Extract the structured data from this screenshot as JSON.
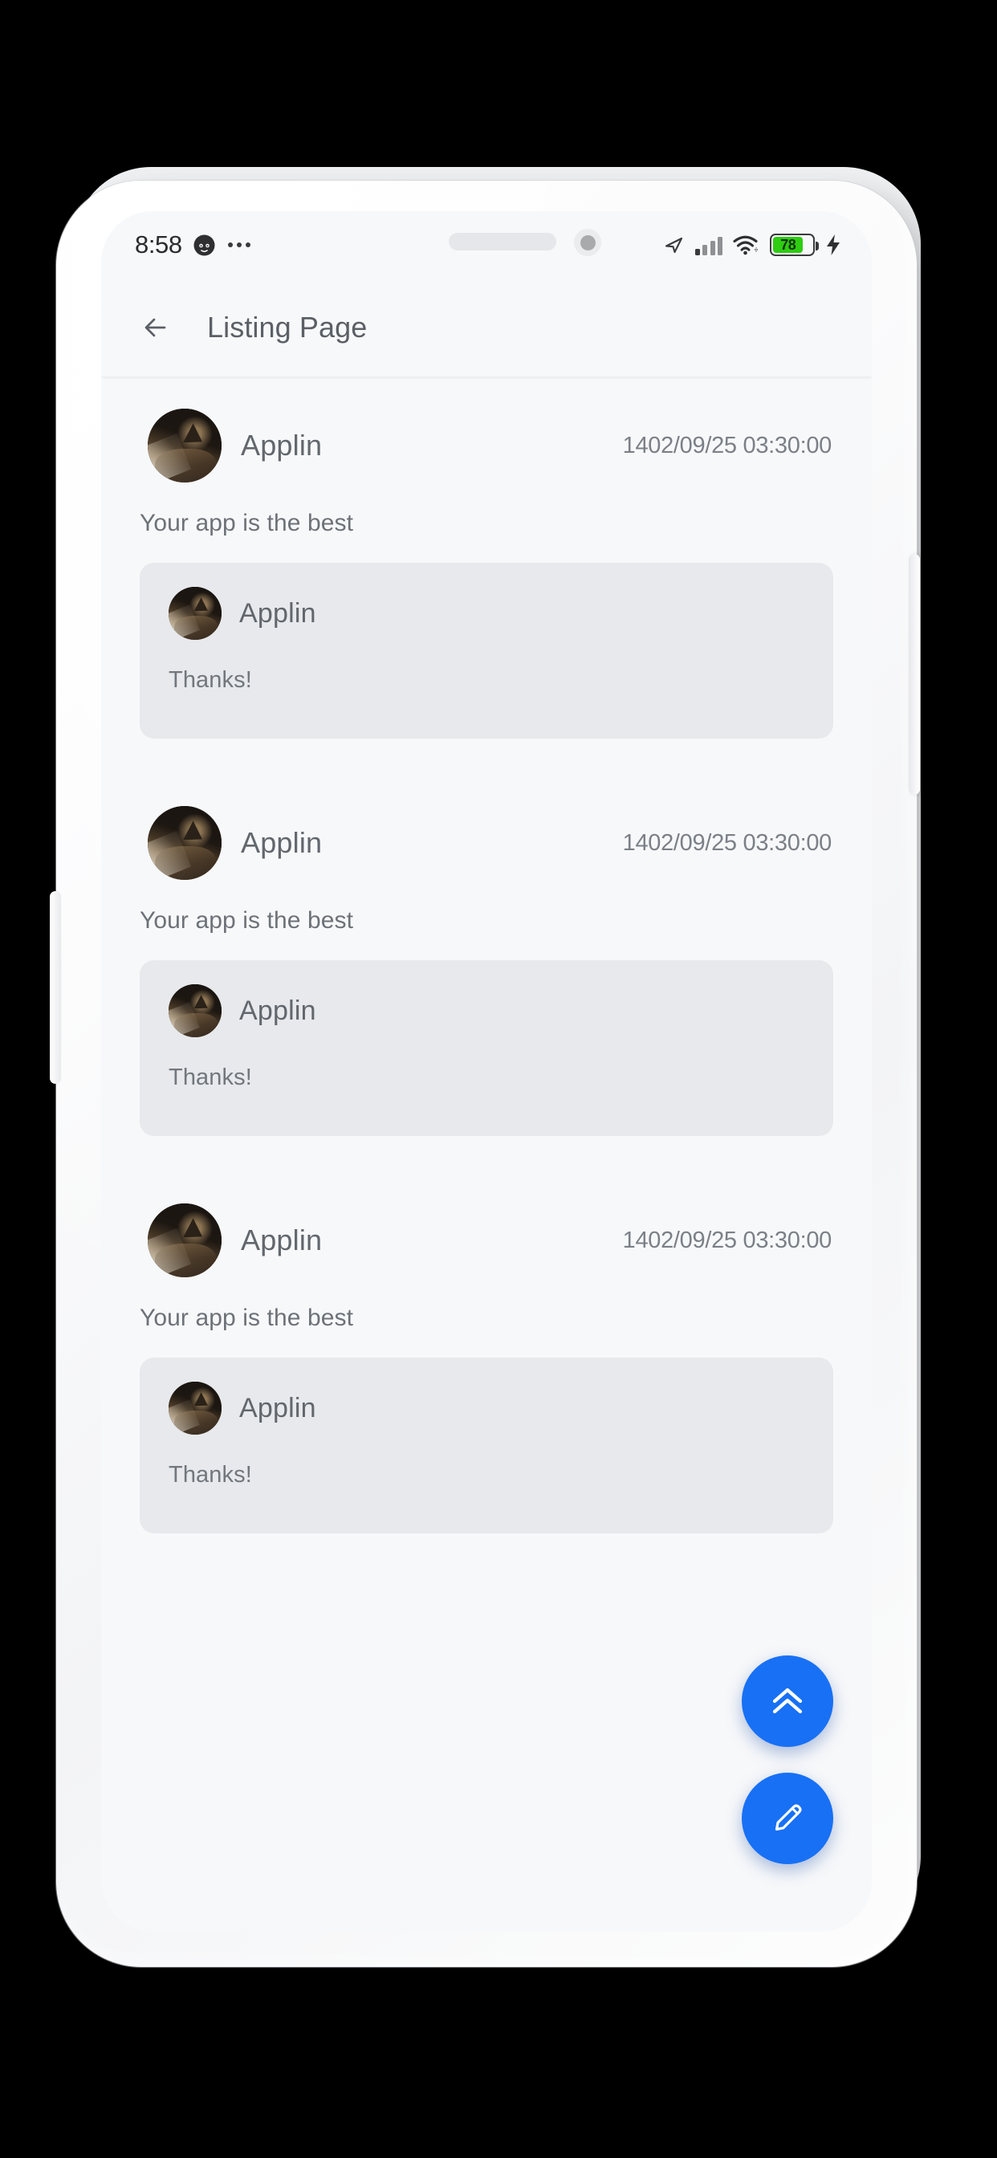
{
  "status_bar": {
    "time": "8:58",
    "emoji_icon": "face-emoji-icon",
    "overflow_icon": "more-dots-icon",
    "nav_icon": "navigation-arrow-icon",
    "signal_icon": "cellular-signal-icon",
    "wifi_icon": "wifi-icon",
    "battery_level": "78",
    "battery_percent": 78,
    "charging_icon": "charging-bolt-icon",
    "battery_color": "#2ecc12"
  },
  "app_bar": {
    "back_icon": "back-arrow-icon",
    "title": "Listing Page"
  },
  "theme": {
    "accent": "#1870f5",
    "screen_bg": "#f7f8fa",
    "reply_bg": "#e7e9ec",
    "text_primary": "#62676d",
    "text_secondary": "#7b8087"
  },
  "feed": {
    "comments": [
      {
        "author": "Applin",
        "date": "1402/09/25 03:30:00",
        "body": "Your app is the best",
        "avatar": "cat-photo-avatar",
        "reply": {
          "author": "Applin",
          "body": "Thanks!",
          "avatar": "cat-photo-avatar"
        }
      },
      {
        "author": "Applin",
        "date": "1402/09/25 03:30:00",
        "body": "Your app is the best",
        "avatar": "cat-photo-avatar",
        "reply": {
          "author": "Applin",
          "body": "Thanks!",
          "avatar": "cat-photo-avatar"
        }
      },
      {
        "author": "Applin",
        "date": "1402/09/25 03:30:00",
        "body": "Your app is the best",
        "avatar": "cat-photo-avatar",
        "reply": {
          "author": "Applin",
          "body": "Thanks!",
          "avatar": "cat-photo-avatar"
        }
      }
    ]
  },
  "fabs": {
    "scroll_top_icon": "double-chevron-up-icon",
    "compose_icon": "pencil-edit-icon"
  }
}
